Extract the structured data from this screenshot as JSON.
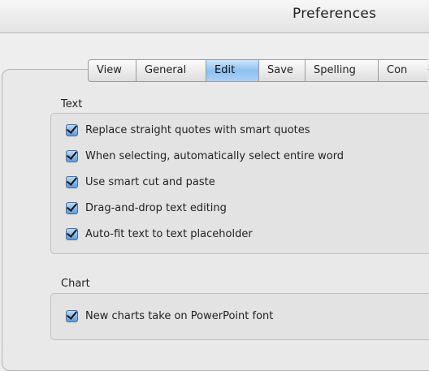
{
  "window": {
    "title": "Preferences"
  },
  "tabs": [
    {
      "label": "View",
      "active": false
    },
    {
      "label": "General",
      "active": false
    },
    {
      "label": "Edit",
      "active": true
    },
    {
      "label": "Save",
      "active": false
    },
    {
      "label": "Spelling",
      "active": false
    },
    {
      "label": "Con",
      "active": false
    }
  ],
  "text_section": {
    "label": "Text",
    "options": [
      {
        "label": "Replace straight quotes with smart quotes",
        "checked": true
      },
      {
        "label": "When selecting, automatically select entire word",
        "checked": true
      },
      {
        "label": "Use smart cut and paste",
        "checked": true
      },
      {
        "label": "Drag-and-drop text editing",
        "checked": true
      },
      {
        "label": "Auto-fit text to text placeholder",
        "checked": true
      }
    ]
  },
  "chart_section": {
    "label": "Chart",
    "options": [
      {
        "label": "New charts take on PowerPoint font",
        "checked": true
      }
    ]
  },
  "colors": {
    "accent": "#8ec0ef",
    "checkbox": "#5d9ad8"
  }
}
